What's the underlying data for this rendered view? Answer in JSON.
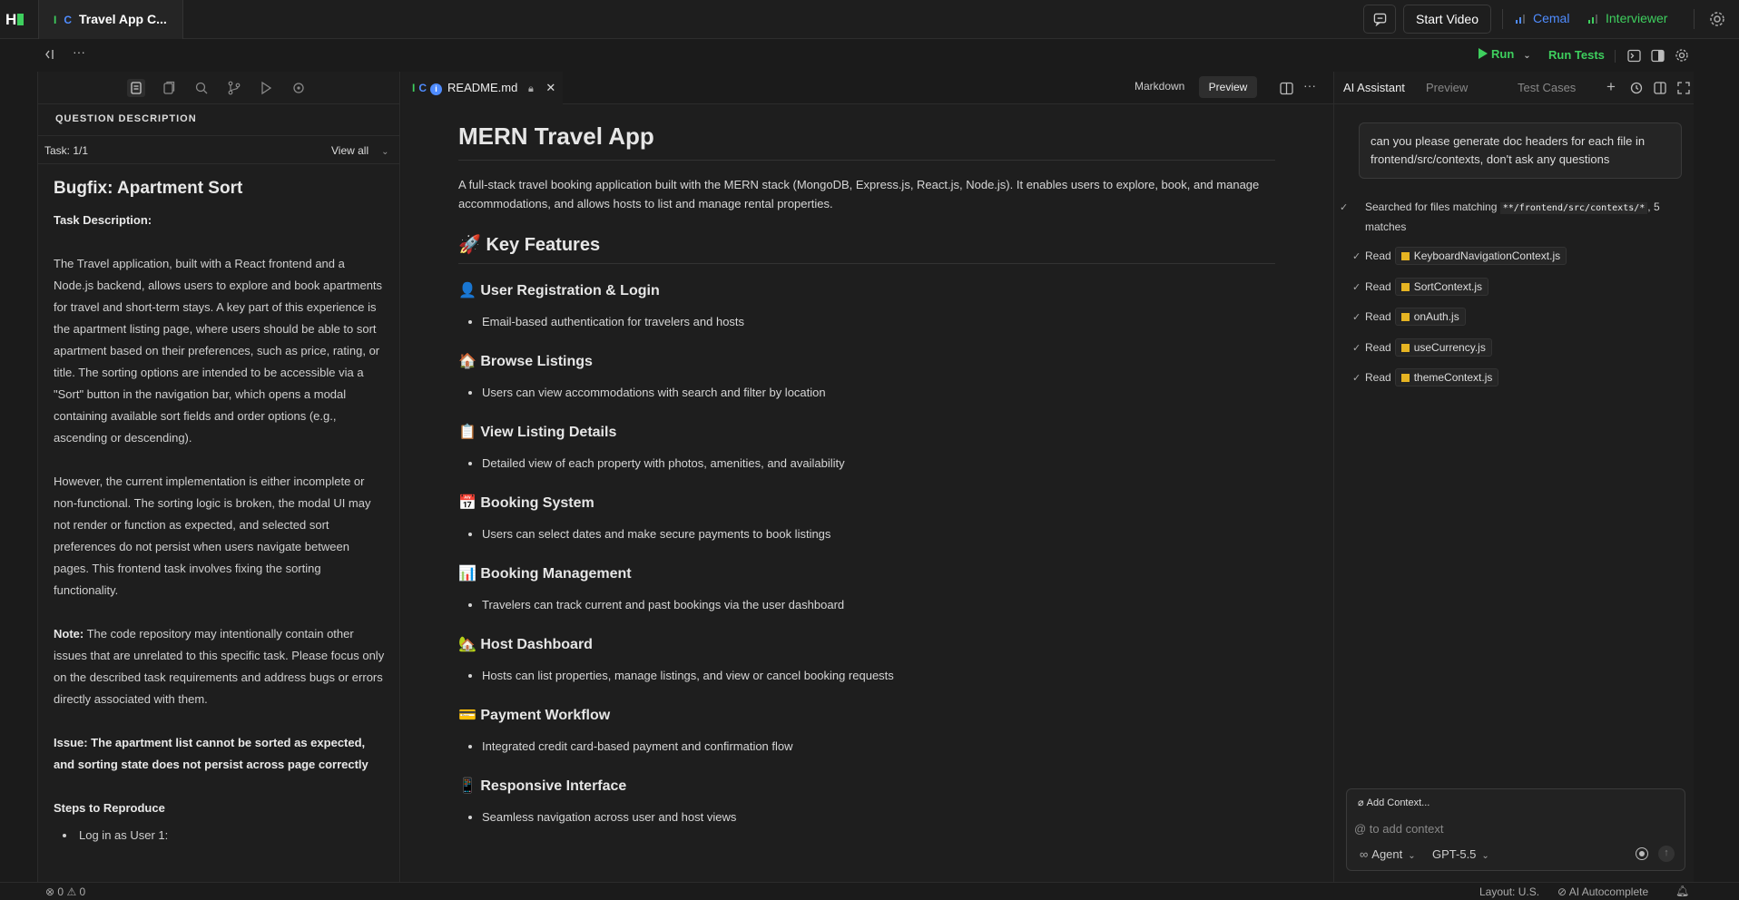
{
  "top": {
    "tab_title": "Travel App C...",
    "tab_icon_1": "I",
    "tab_icon_2": "C",
    "start_video": "Start Video",
    "user_1": "Cemal",
    "user_2": "Interviewer"
  },
  "toolbar": {
    "run": "Run",
    "run_tests": "Run Tests"
  },
  "left": {
    "section_title": "QUESTION DESCRIPTION",
    "task_label": "Task: 1/1",
    "view_all": "View all",
    "title": "Bugfix: Apartment Sort",
    "task_description_label": "Task Description:",
    "para_1": "The Travel application, built with a React frontend and a Node.js backend, allows users to explore and book apartments for travel and short-term stays. A key part of this experience is the apartment listing page, where users should be able to sort apartment based on their preferences, such as price, rating, or title. The sorting options are intended to be accessible via a \"Sort\" button in the navigation bar, which opens a modal containing available sort fields and order options (e.g., ascending or descending).",
    "para_2": "However, the current implementation is either incomplete or non-functional. The sorting logic is broken, the modal UI may not render or function as expected, and selected sort preferences do not persist when users navigate between pages. This frontend task involves fixing the sorting functionality.",
    "note_label": "Note:",
    "note_text": " The code repository may intentionally contain other issues that are unrelated to this specific task. Please focus only on the described task requirements and address bugs or errors directly associated with them.",
    "issue": "Issue: The apartment list cannot be sorted as expected, and sorting state does not persist across page correctly",
    "steps_title": "Steps to Reproduce",
    "step_1": "Log in as User 1:"
  },
  "editor": {
    "tab_icon_1": "I",
    "tab_icon_2": "C",
    "info_glyph": "i",
    "file_name": "README.md",
    "markdown_label": "Markdown",
    "preview_label": "Preview",
    "h1": "MERN Travel App",
    "intro": "A full-stack travel booking application built with the MERN stack (MongoDB, Express.js, React.js, Node.js). It enables users to explore, book, and manage accommodations, and allows hosts to list and manage rental properties.",
    "h2": "🚀 Key Features",
    "features": [
      {
        "title": "👤 User Registration & Login",
        "text": "Email-based authentication for travelers and hosts"
      },
      {
        "title": "🏠 Browse Listings",
        "text": "Users can view accommodations with search and filter by location"
      },
      {
        "title": "📋 View Listing Details",
        "text": "Detailed view of each property with photos, amenities, and availability"
      },
      {
        "title": "📅 Booking System",
        "text": "Users can select dates and make secure payments to book listings"
      },
      {
        "title": "📊 Booking Management",
        "text": "Travelers can track current and past bookings via the user dashboard"
      },
      {
        "title": "🏡 Host Dashboard",
        "text": "Hosts can list properties, manage listings, and view or cancel booking requests"
      },
      {
        "title": "💳 Payment Workflow",
        "text": "Integrated credit card-based payment and confirmation flow"
      },
      {
        "title": "📱 Responsive Interface",
        "text": "Seamless navigation across user and host views"
      }
    ]
  },
  "right": {
    "tab_ai": "AI Assistant",
    "tab_preview": "Preview",
    "tab_tests": "Test Cases",
    "user_message": "can you please generate doc headers for each file in frontend/src/contexts, don't ask any questions",
    "search_prefix": "Searched for files matching ",
    "search_pattern": "**/frontend/src/contexts/*",
    "search_suffix": ", 5 matches",
    "read_label": "Read",
    "files": [
      "KeyboardNavigationContext.js",
      "SortContext.js",
      "onAuth.js",
      "useCurrency.js",
      "themeContext.js"
    ],
    "add_context": "Add Context...",
    "context_placeholder": "@ to add context",
    "agent": "Agent",
    "model": "GPT-5.5"
  },
  "status": {
    "errors": "0",
    "warnings": "0",
    "layout": "Layout: U.S.",
    "autocomplete": "AI Autocomplete"
  },
  "colors": {
    "accent_green": "#3ecf5e",
    "accent_blue": "#4f8cff"
  }
}
